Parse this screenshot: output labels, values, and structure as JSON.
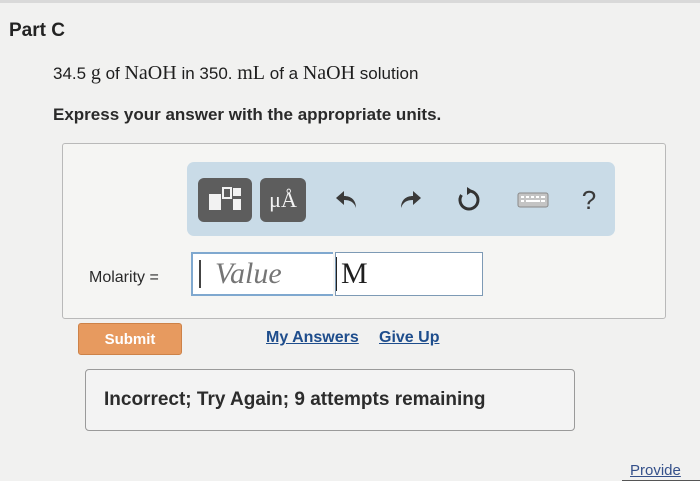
{
  "part": {
    "title": "Part C"
  },
  "problem": {
    "mass": "34.5",
    "mass_unit": "g",
    "of_text": "of",
    "solute": "NaOH",
    "in_text": "in",
    "volume": "350.",
    "volume_unit": "mL",
    "of_a_text": "of a",
    "solvent_formula": "NaOH",
    "solution_text": "solution",
    "instructions": "Express your answer with the appropriate units."
  },
  "toolbar": {
    "items": [
      "templates-icon",
      "units-icon",
      "undo-icon",
      "redo-icon",
      "reset-icon",
      "keyboard-icon",
      "help-icon"
    ],
    "units_label": "μÅ",
    "help_label": "?"
  },
  "answer": {
    "label": "Molarity =",
    "value_placeholder": "Value",
    "unit": "M"
  },
  "actions": {
    "submit_label": "Submit",
    "my_answers_label": "My Answers",
    "give_up_label": "Give Up"
  },
  "feedback": {
    "message": "Incorrect; Try Again; 9 attempts remaining"
  },
  "footer": {
    "provide_label": "Provide"
  },
  "colors": {
    "submit": "#e79a5f",
    "toolbar": "#c9dbe7",
    "link": "#1e4d8c"
  }
}
